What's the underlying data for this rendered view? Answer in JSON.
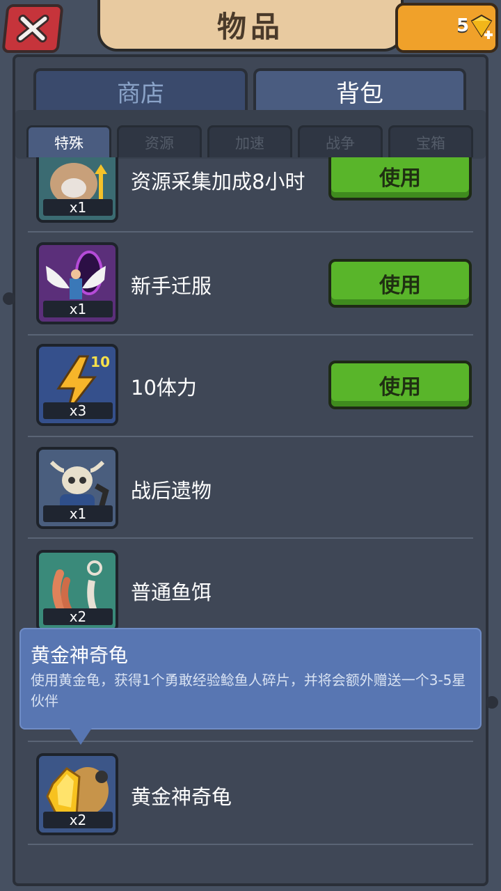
{
  "header": {
    "title": "物品",
    "gems": "5"
  },
  "tabs": [
    {
      "label": "商店",
      "active": false
    },
    {
      "label": "背包",
      "active": true
    }
  ],
  "subtabs": [
    {
      "label": "特殊",
      "active": true
    },
    {
      "label": "资源",
      "active": false
    },
    {
      "label": "加速",
      "active": false
    },
    {
      "label": "战争",
      "active": false
    },
    {
      "label": "宝箱",
      "active": false
    }
  ],
  "items": [
    {
      "name": "资源采集加成8小时",
      "qty": "x1",
      "button": "使用",
      "icon": "yak-warrior-icon"
    },
    {
      "name": "新手迁服",
      "qty": "x1",
      "button": "使用",
      "icon": "winged-portal-icon"
    },
    {
      "name": "10体力",
      "qty": "x3",
      "button": "使用",
      "icon": "lightning-icon",
      "badge": "10"
    },
    {
      "name": "战后遗物",
      "qty": "x1",
      "icon": "skull-relic-icon"
    },
    {
      "name": "普通鱼饵",
      "qty": "x2",
      "icon": "worm-bait-icon"
    },
    {
      "name": "黄金神奇龟",
      "qty": "x2",
      "icon": "golden-turtle-icon"
    }
  ],
  "tooltip": {
    "title": "黄金神奇龟",
    "description": "使用黄金龟，获得1个勇敢经验鲶鱼人碎片，并将会额外赠送一个3-5星伙伴"
  },
  "colors": {
    "use_button": "#59b52a",
    "tooltip_bg": "#5876b2",
    "close_button": "#c6343b",
    "gem_box": "#f0a12a"
  }
}
